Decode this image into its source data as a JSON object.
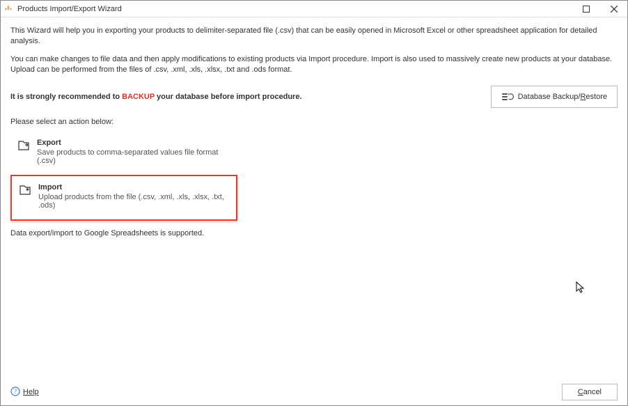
{
  "titlebar": {
    "title": "Products Import/Export Wizard"
  },
  "content": {
    "intro1": "This Wizard will help you in exporting your products to delimiter-separated file (.csv) that can be easily opened in Microsoft Excel or other spreadsheet application for detailed analysis.",
    "intro2": "You can make changes to file data and then apply modifications to existing products via Import procedure. Import is also used to massively create new products at your database. Upload can be performed from the files of .csv, .xml, .xls, .xlsx, .txt and .ods format.",
    "recommend_prefix": "It is strongly recommended to ",
    "recommend_backup": "BACKUP",
    "recommend_suffix": " your database before import procedure.",
    "backup_button_prefix": "Database Backup/",
    "backup_button_key": "R",
    "backup_button_suffix": "estore",
    "select_label": "Please select an action below:",
    "options": {
      "export": {
        "title": "Export",
        "desc": "Save products to comma-separated values file format (.csv)"
      },
      "import": {
        "title": "Import",
        "desc": "Upload products from the file (.csv, .xml, .xls, .xlsx, .txt, .ods)"
      }
    },
    "google_note": "Data export/import to Google Spreadsheets is supported."
  },
  "footer": {
    "help_key": "H",
    "help_suffix": "elp",
    "cancel_key": "C",
    "cancel_suffix": "ancel"
  }
}
